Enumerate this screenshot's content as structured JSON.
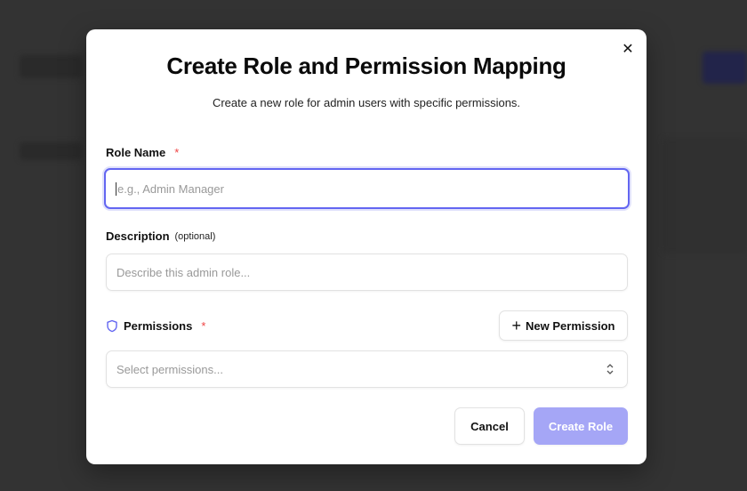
{
  "dialog": {
    "title": "Create Role and Permission Mapping",
    "subtitle": "Create a new role for admin users with specific permissions.",
    "close_icon": "x-icon",
    "role_name": {
      "label": "Role Name",
      "required_mark": "*",
      "placeholder": "e.g., Admin Manager",
      "value": ""
    },
    "description": {
      "label": "Description",
      "optional_note": "(optional)",
      "placeholder": "Describe this admin role...",
      "value": ""
    },
    "permissions": {
      "label": "Permissions",
      "required_mark": "*",
      "icon": "shield-icon",
      "placeholder": "Select permissions...",
      "new_button": "New Permission"
    },
    "cancel_label": "Cancel",
    "submit_label": "Create Role"
  },
  "colors": {
    "accent": "#6366f1",
    "submit_disabled": "#a5a6f6",
    "required": "#ef4444",
    "overlay": "#333333"
  }
}
